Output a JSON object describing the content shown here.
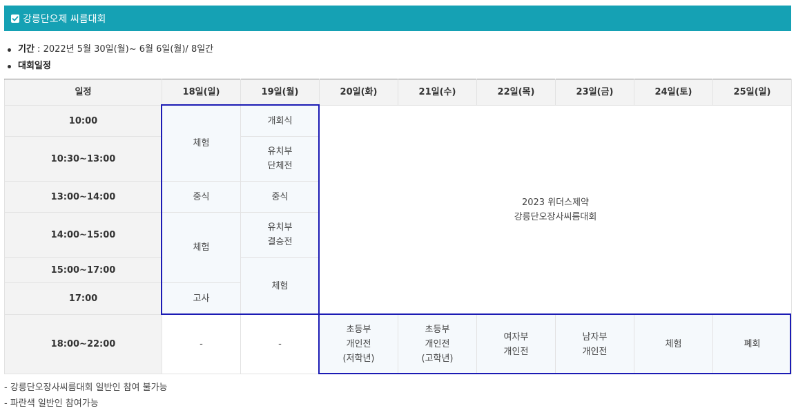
{
  "section_title": "강릉단오제 씨름대회",
  "info": {
    "period_label": "기간",
    "period_value": " : 2022년 5월 30일(월)~ 6월 6일(월)/ 8일간",
    "schedule_label": "대회일정"
  },
  "table": {
    "headers": [
      "일정",
      "18일(일)",
      "19일(월)",
      "20일(화)",
      "21일(수)",
      "22일(목)",
      "23일(금)",
      "24일(토)",
      "25일(일)"
    ],
    "times": [
      "10:00",
      "10:30~13:00",
      "13:00~14:00",
      "14:00~15:00",
      "15:00~17:00",
      "17:00",
      "18:00~22:00"
    ],
    "day18": {
      "experience1": "체험",
      "lunch": "중식",
      "experience2": "체험",
      "exam": "고사",
      "evening": "-"
    },
    "day19": {
      "opening": "개회식",
      "kinder_team": "유치부\n단체전",
      "lunch": "중식",
      "kinder_final": "유치부\n결승전",
      "experience": "체험",
      "evening": "-"
    },
    "tournament": "2023 위더스제약\n강릉단오장사씨름대회",
    "evening": {
      "d20": "초등부\n개인전\n(저학년)",
      "d21": "초등부\n개인전\n(고학년)",
      "d22": "여자부\n개인전",
      "d23": "남자부\n개인전",
      "d24": "체험",
      "d25": "폐회"
    }
  },
  "notes": [
    "- 강릉단오장사씨름대회 일반인 참여 불가능",
    "- 파란색 일반인 참여가능"
  ],
  "colors": {
    "title_bg": "#15a1b4",
    "highlight_border": "#1b1bb4",
    "header_bg": "#f3f3f3"
  }
}
